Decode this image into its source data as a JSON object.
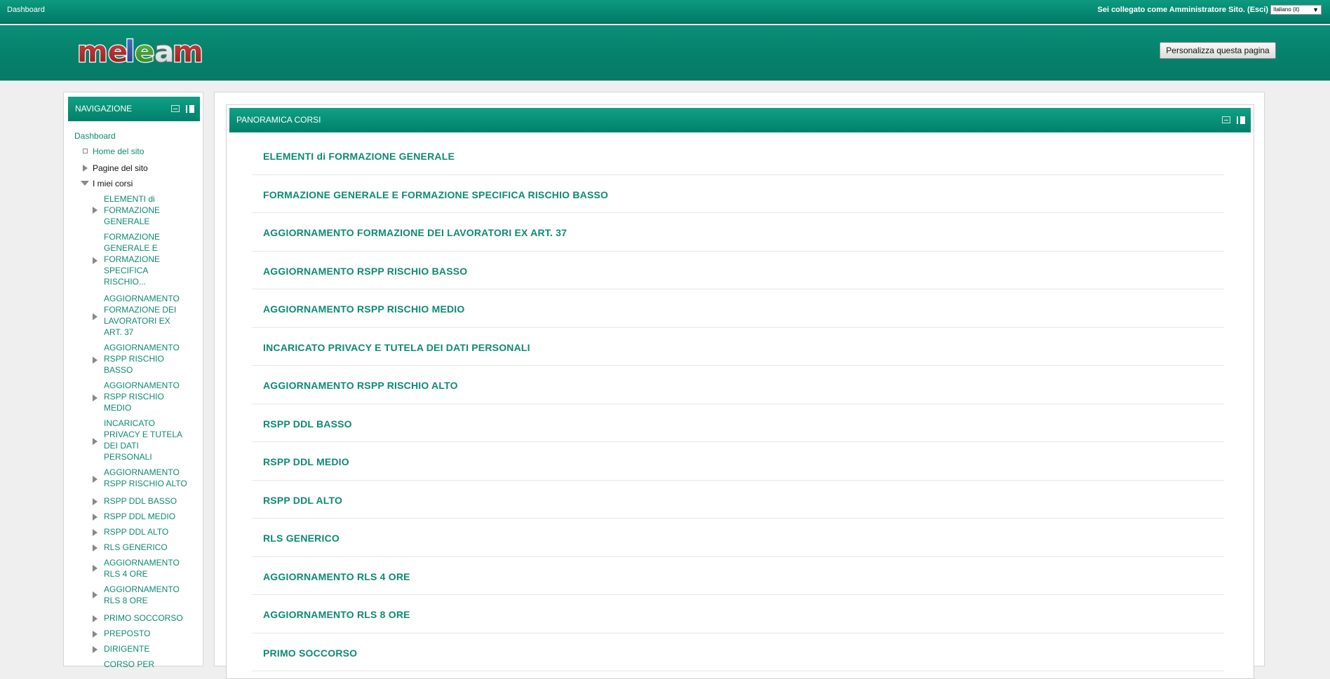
{
  "topbar": {
    "home_label": "Dashboard",
    "login_text": "Sei collegato come Amministratore Sito. (Esci)",
    "language_selected": "Italiano (it)",
    "dropdown_arrow": "▼"
  },
  "header": {
    "logo_alt": "meleam",
    "customize_label": "Personalizza questa pagina"
  },
  "navigation": {
    "title": "NAVIGAZIONE",
    "dashboard": "Dashboard",
    "home_site": "Home del sito",
    "site_pages": "Pagine del sito",
    "my_courses": "I miei corsi",
    "courses": [
      [
        "ELEMENTI di",
        "FORMAZIONE",
        "GENERALE"
      ],
      [
        "FORMAZIONE",
        "GENERALE E",
        "FORMAZIONE",
        "SPECIFICA",
        "RISCHIO..."
      ],
      [
        "AGGIORNAMENTO",
        "FORMAZIONE DEI",
        "LAVORATORI EX",
        "ART. 37"
      ],
      [
        "AGGIORNAMENTO",
        "RSPP RISCHIO",
        "BASSO"
      ],
      [
        "AGGIORNAMENTO",
        "RSPP RISCHIO",
        "MEDIO"
      ],
      [
        "INCARICATO",
        "PRIVACY E TUTELA",
        "DEI DATI",
        "PERSONALI"
      ],
      [
        "AGGIORNAMENTO",
        "RSPP RISCHIO ALTO"
      ],
      [
        "RSPP DDL BASSO"
      ],
      [
        "RSPP DDL MEDIO"
      ],
      [
        "RSPP DDL ALTO"
      ],
      [
        "RLS GENERICO"
      ],
      [
        "AGGIORNAMENTO",
        "RLS 4 ORE"
      ],
      [
        "AGGIORNAMENTO",
        "RLS 8 ORE"
      ],
      [
        "PRIMO SOCCORSO"
      ],
      [
        "PREPOSTO"
      ],
      [
        "DIRIGENTE"
      ],
      [
        "CORSO PER"
      ]
    ]
  },
  "course_overview": {
    "title": "PANORAMICA CORSI",
    "courses": [
      "ELEMENTI di FORMAZIONE GENERALE",
      "FORMAZIONE GENERALE E FORMAZIONE SPECIFICA RISCHIO BASSO",
      "AGGIORNAMENTO FORMAZIONE DEI LAVORATORI EX ART. 37",
      "AGGIORNAMENTO RSPP RISCHIO BASSO",
      "AGGIORNAMENTO RSPP RISCHIO MEDIO",
      "INCARICATO PRIVACY E TUTELA DEI DATI PERSONALI",
      "AGGIORNAMENTO RSPP RISCHIO ALTO",
      "RSPP DDL BASSO",
      "RSPP DDL MEDIO",
      "RSPP DDL ALTO",
      "RLS GENERICO",
      "AGGIORNAMENTO RLS 4 ORE",
      "AGGIORNAMENTO RLS 8 ORE",
      "PRIMO SOCCORSO"
    ]
  },
  "colors": {
    "brand": "#008a72",
    "link": "#0e8a74"
  }
}
